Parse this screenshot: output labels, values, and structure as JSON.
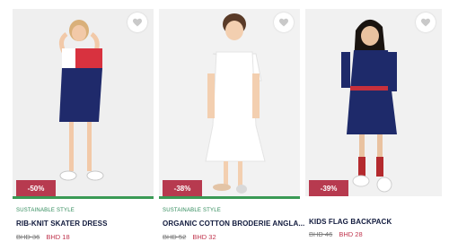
{
  "colors": {
    "sale_badge": "#b73a4f",
    "green_bar": "#3a9a55",
    "sustainable_tag": "#2f8a5a",
    "new_price": "#c0364f"
  },
  "products": [
    {
      "discount": "-50%",
      "tag": "SUSTAINABLE STYLE",
      "title": "RIB-KNIT SKATER DRESS",
      "old_price": "BHD 36",
      "new_price": "BHD 18",
      "favorite_icon": "heart-outline-icon"
    },
    {
      "discount": "-38%",
      "tag": "SUSTAINABLE STYLE",
      "title": "ORGANIC COTTON BRODERIE ANGLA...",
      "old_price": "BHD 52",
      "new_price": "BHD 32",
      "favorite_icon": "heart-outline-icon"
    },
    {
      "discount": "-39%",
      "title": "KIDS FLAG BACKPACK",
      "old_price": "BHD 46",
      "new_price": "BHD 28",
      "favorite_icon": "heart-outline-icon"
    }
  ]
}
